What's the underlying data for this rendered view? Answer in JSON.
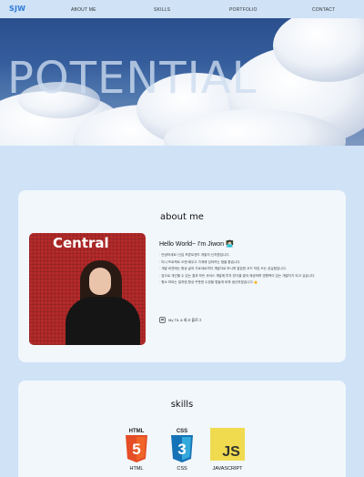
{
  "nav": {
    "logo": "SJW",
    "items": [
      "ABOUT ME",
      "SKILLS",
      "PORTFOLIO",
      "CONTACT"
    ]
  },
  "hero": {
    "title": "POTENTIAL"
  },
  "about": {
    "title": "about me",
    "photo_sign": "Central",
    "greeting": "Hello World~ I'm Jiwon",
    "greeting_emoji": "👩🏻‍💻",
    "bio": [
      "· 안녕하세요! 신입 프론트엔드 개발자 신지원입니다.",
      "· 미니 프로젝트 오랜 배우고 가게에 임하려는 점을 좋습니다.",
      "· 개발 비전에는 항상 글의 가로세로까지 개발자로 보시며 깔끔한 코드 작업 쓰는 성실함입니다.",
      "· 앞으로 개선할 수 있는 결과 모든 서비스 개발에 투자 방식을 결국 제공하며 영향력이 있는 개발자가 되고 싶습니다.",
      "· 평소 하되는 일처럼 항상 꾸준한 수정을 힘들게 바꿔 생산하겠습니다 👍"
    ],
    "blog_link_label": "My TIL & 회고 블로그"
  },
  "skills": {
    "title": "skills",
    "items": [
      {
        "badge": "HTML",
        "number": "5",
        "label": "HTML",
        "color": "#e44d26",
        "icon": "html5-icon"
      },
      {
        "badge": "CSS",
        "number": "3",
        "label": "CSS",
        "color": "#1572b6",
        "icon": "css3-icon"
      },
      {
        "badge": "JS",
        "number": "",
        "label": "JAVASCRIPT",
        "color": "#f0db4f",
        "icon": "javascript-icon"
      }
    ]
  },
  "colors": {
    "background": "#cfe2f6",
    "card": "#f2f7fc",
    "accent": "#2f7bd8"
  }
}
